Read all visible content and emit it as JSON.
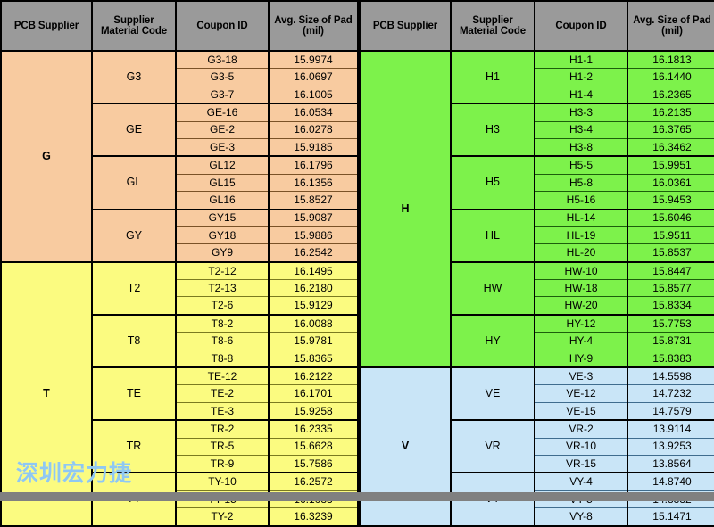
{
  "headers": {
    "pcb_supplier": "PCB Supplier",
    "material_code_line1": "Supplier",
    "material_code_line2": "Material Code",
    "coupon_id": "Coupon ID",
    "avg_pad_line1": "Avg. Size of Pad",
    "avg_pad_line2": "(mil)"
  },
  "watermark": "深圳宏力捷",
  "colors": {
    "header_bg": "#9a9a9a",
    "supplier_g": "#F8CBA0",
    "supplier_t": "#FBFB80",
    "supplier_h": "#7DF24B",
    "supplier_v": "#C9E5F7",
    "grid": "#000000",
    "watermark": "#8FC8F2",
    "page_bg": "#808080"
  },
  "left_table": {
    "suppliers": [
      {
        "name": "G",
        "theme": "c-g",
        "groups": [
          {
            "code": "G3",
            "rows": [
              {
                "coupon": "G3-18",
                "avg": "15.9974"
              },
              {
                "coupon": "G3-5",
                "avg": "16.0697"
              },
              {
                "coupon": "G3-7",
                "avg": "16.1005"
              }
            ]
          },
          {
            "code": "GE",
            "rows": [
              {
                "coupon": "GE-16",
                "avg": "16.0534"
              },
              {
                "coupon": "GE-2",
                "avg": "16.0278"
              },
              {
                "coupon": "GE-3",
                "avg": "15.9185"
              }
            ]
          },
          {
            "code": "GL",
            "rows": [
              {
                "coupon": "GL12",
                "avg": "16.1796"
              },
              {
                "coupon": "GL15",
                "avg": "16.1356"
              },
              {
                "coupon": "GL16",
                "avg": "15.8527"
              }
            ]
          },
          {
            "code": "GY",
            "rows": [
              {
                "coupon": "GY15",
                "avg": "15.9087"
              },
              {
                "coupon": "GY18",
                "avg": "15.9886"
              },
              {
                "coupon": "GY9",
                "avg": "16.2542"
              }
            ]
          }
        ]
      },
      {
        "name": "T",
        "theme": "c-t",
        "groups": [
          {
            "code": "T2",
            "rows": [
              {
                "coupon": "T2-12",
                "avg": "16.1495"
              },
              {
                "coupon": "T2-13",
                "avg": "16.2180"
              },
              {
                "coupon": "T2-6",
                "avg": "15.9129"
              }
            ]
          },
          {
            "code": "T8",
            "rows": [
              {
                "coupon": "T8-2",
                "avg": "16.0088"
              },
              {
                "coupon": "T8-6",
                "avg": "15.9781"
              },
              {
                "coupon": "T8-8",
                "avg": "15.8365"
              }
            ]
          },
          {
            "code": "TE",
            "rows": [
              {
                "coupon": "TE-12",
                "avg": "16.2122"
              },
              {
                "coupon": "TE-2",
                "avg": "16.1701"
              },
              {
                "coupon": "TE-3",
                "avg": "15.9258"
              }
            ]
          },
          {
            "code": "TR",
            "rows": [
              {
                "coupon": "TR-2",
                "avg": "16.2335"
              },
              {
                "coupon": "TR-5",
                "avg": "15.6628"
              },
              {
                "coupon": "TR-9",
                "avg": "15.7586"
              }
            ]
          },
          {
            "code": "TY",
            "rows": [
              {
                "coupon": "TY-10",
                "avg": "16.2572"
              },
              {
                "coupon": "TY-15",
                "avg": "16.1083"
              },
              {
                "coupon": "TY-2",
                "avg": "16.3239"
              }
            ]
          }
        ]
      }
    ]
  },
  "right_table": {
    "suppliers": [
      {
        "name": "H",
        "theme": "c-h",
        "groups": [
          {
            "code": "H1",
            "rows": [
              {
                "coupon": "H1-1",
                "avg": "16.1813"
              },
              {
                "coupon": "H1-2",
                "avg": "16.1440"
              },
              {
                "coupon": "H1-4",
                "avg": "16.2365"
              }
            ]
          },
          {
            "code": "H3",
            "rows": [
              {
                "coupon": "H3-3",
                "avg": "16.2135"
              },
              {
                "coupon": "H3-4",
                "avg": "16.3765"
              },
              {
                "coupon": "H3-8",
                "avg": "16.3462"
              }
            ]
          },
          {
            "code": "H5",
            "rows": [
              {
                "coupon": "H5-5",
                "avg": "15.9951"
              },
              {
                "coupon": "H5-8",
                "avg": "16.0361"
              },
              {
                "coupon": "H5-16",
                "avg": "15.9453"
              }
            ]
          },
          {
            "code": "HL",
            "rows": [
              {
                "coupon": "HL-14",
                "avg": "15.6046"
              },
              {
                "coupon": "HL-19",
                "avg": "15.9511"
              },
              {
                "coupon": "HL-20",
                "avg": "15.8537"
              }
            ]
          },
          {
            "code": "HW",
            "rows": [
              {
                "coupon": "HW-10",
                "avg": "15.8447"
              },
              {
                "coupon": "HW-18",
                "avg": "15.8577"
              },
              {
                "coupon": "HW-20",
                "avg": "15.8334"
              }
            ]
          },
          {
            "code": "HY",
            "rows": [
              {
                "coupon": "HY-12",
                "avg": "15.7753"
              },
              {
                "coupon": "HY-4",
                "avg": "15.8731"
              },
              {
                "coupon": "HY-9",
                "avg": "15.8383"
              }
            ]
          }
        ]
      },
      {
        "name": "V",
        "theme": "c-v",
        "groups": [
          {
            "code": "VE",
            "rows": [
              {
                "coupon": "VE-3",
                "avg": "14.5598"
              },
              {
                "coupon": "VE-12",
                "avg": "14.7232"
              },
              {
                "coupon": "VE-15",
                "avg": "14.7579"
              }
            ]
          },
          {
            "code": "VR",
            "rows": [
              {
                "coupon": "VR-2",
                "avg": "13.9114"
              },
              {
                "coupon": "VR-10",
                "avg": "13.9253"
              },
              {
                "coupon": "VR-15",
                "avg": "13.8564"
              }
            ]
          },
          {
            "code": "VY",
            "rows": [
              {
                "coupon": "VY-4",
                "avg": "14.8740"
              },
              {
                "coupon": "VY-5",
                "avg": "14.8332"
              },
              {
                "coupon": "VY-8",
                "avg": "15.1471"
              }
            ]
          }
        ]
      }
    ]
  }
}
